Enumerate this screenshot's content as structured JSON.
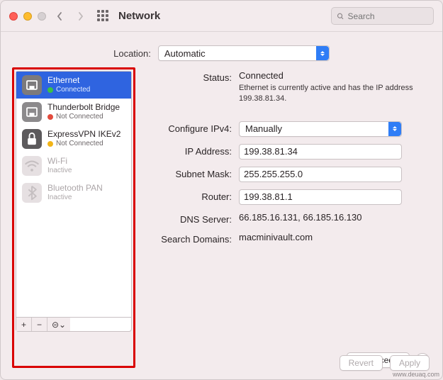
{
  "title": "Network",
  "search_placeholder": "Search",
  "location": {
    "label": "Location:",
    "value": "Automatic"
  },
  "sidebar": {
    "items": [
      {
        "name": "Ethernet",
        "status": "Connected",
        "dot": "sd-green",
        "icon": "ethernet",
        "selected": true,
        "dim": false
      },
      {
        "name": "Thunderbolt Bridge",
        "status": "Not Connected",
        "dot": "sd-red",
        "icon": "thunderbolt",
        "selected": false,
        "dim": false
      },
      {
        "name": "ExpressVPN IKEv2",
        "status": "Not Connected",
        "dot": "sd-yellow",
        "icon": "lock",
        "selected": false,
        "dim": false
      },
      {
        "name": "Wi-Fi",
        "status": "Inactive",
        "dot": "",
        "icon": "wifi",
        "selected": false,
        "dim": true
      },
      {
        "name": "Bluetooth PAN",
        "status": "Inactive",
        "dot": "",
        "icon": "bluetooth",
        "selected": false,
        "dim": true
      }
    ],
    "foot": {
      "add": "+",
      "remove": "−",
      "actions": "⊝⌄"
    }
  },
  "detail": {
    "status_label": "Status:",
    "status_value": "Connected",
    "status_desc": "Ethernet is currently active and has the IP address 199.38.81.34.",
    "configure_label": "Configure IPv4:",
    "configure_value": "Manually",
    "ip_label": "IP Address:",
    "ip_value": "199.38.81.34",
    "subnet_label": "Subnet Mask:",
    "subnet_value": "255.255.255.0",
    "router_label": "Router:",
    "router_value": "199.38.81.1",
    "dns_label": "DNS Server:",
    "dns_value": "66.185.16.131, 66.185.16.130",
    "search_label": "Search Domains:",
    "search_value": "macminivault.com",
    "advanced": "Advanced...",
    "help": "?"
  },
  "footer": {
    "revert": "Revert",
    "apply": "Apply"
  },
  "watermark": "www.deuaq.com"
}
